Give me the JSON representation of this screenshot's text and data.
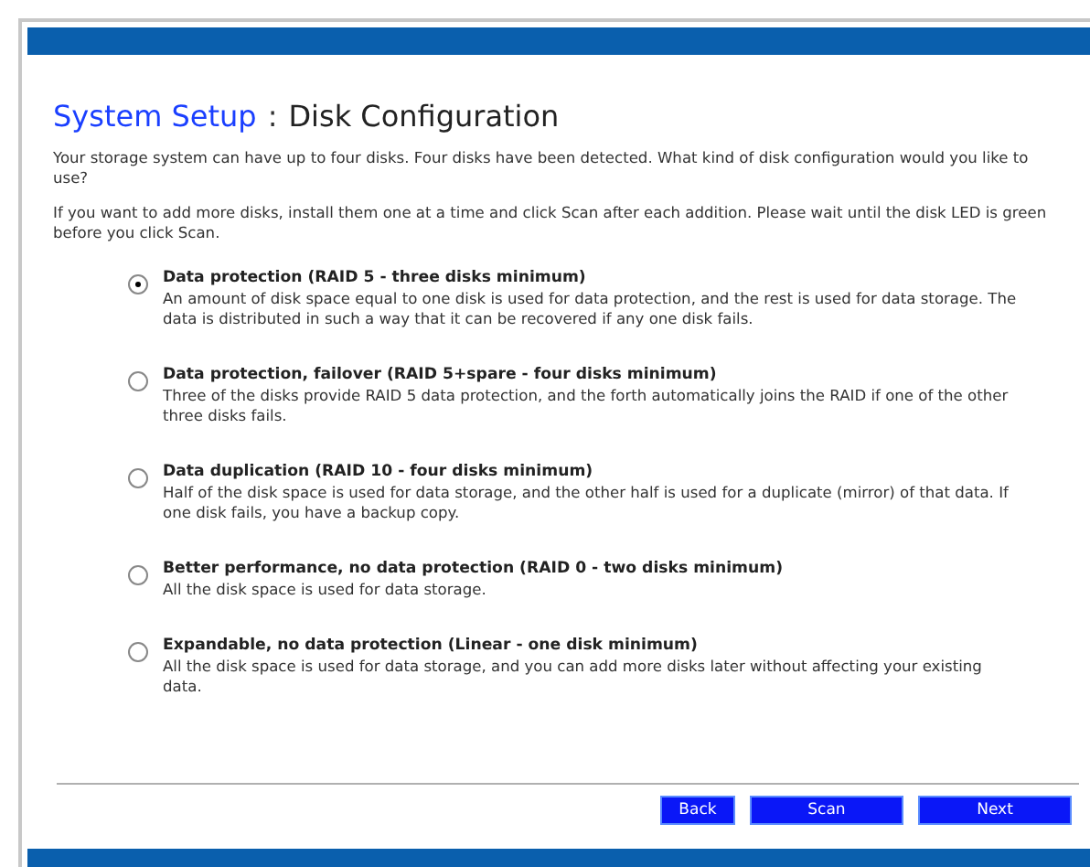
{
  "title": {
    "section": "System Setup",
    "separator": ":",
    "page": "Disk Configuration"
  },
  "intro": [
    "Your storage system can have up to four disks. Four disks have been detected. What kind of disk configuration would you like to use?",
    "If you want to add more disks, install them one at a time and click Scan after each addition. Please wait until the disk LED is green before you click Scan."
  ],
  "options": [
    {
      "label": "Data protection (RAID 5 - three disks minimum)",
      "description": "An amount of disk space equal to one disk is used for data protection, and the rest is used for data storage. The data is distributed in such a way that it can be recovered if any one disk fails.",
      "selected": true
    },
    {
      "label": "Data protection, failover (RAID 5+spare - four disks minimum)",
      "description": "Three of the disks provide RAID 5 data protection, and the forth automatically joins the RAID if one of the other three disks fails.",
      "selected": false
    },
    {
      "label": "Data duplication (RAID 10 - four disks minimum)",
      "description": "Half of the disk space is used for data storage, and the other half is used for a duplicate (mirror) of that data. If one disk fails, you have a backup copy.",
      "selected": false
    },
    {
      "label": "Better performance, no data protection (RAID 0 - two disks minimum)",
      "description": "All the disk space is used for data storage.",
      "selected": false
    },
    {
      "label": "Expandable, no data protection (Linear - one disk minimum)",
      "description": "All the disk space is used for data storage, and you can add more disks later without affecting your existing data.",
      "selected": false
    }
  ],
  "buttons": [
    "Back",
    "Scan",
    "Next"
  ]
}
